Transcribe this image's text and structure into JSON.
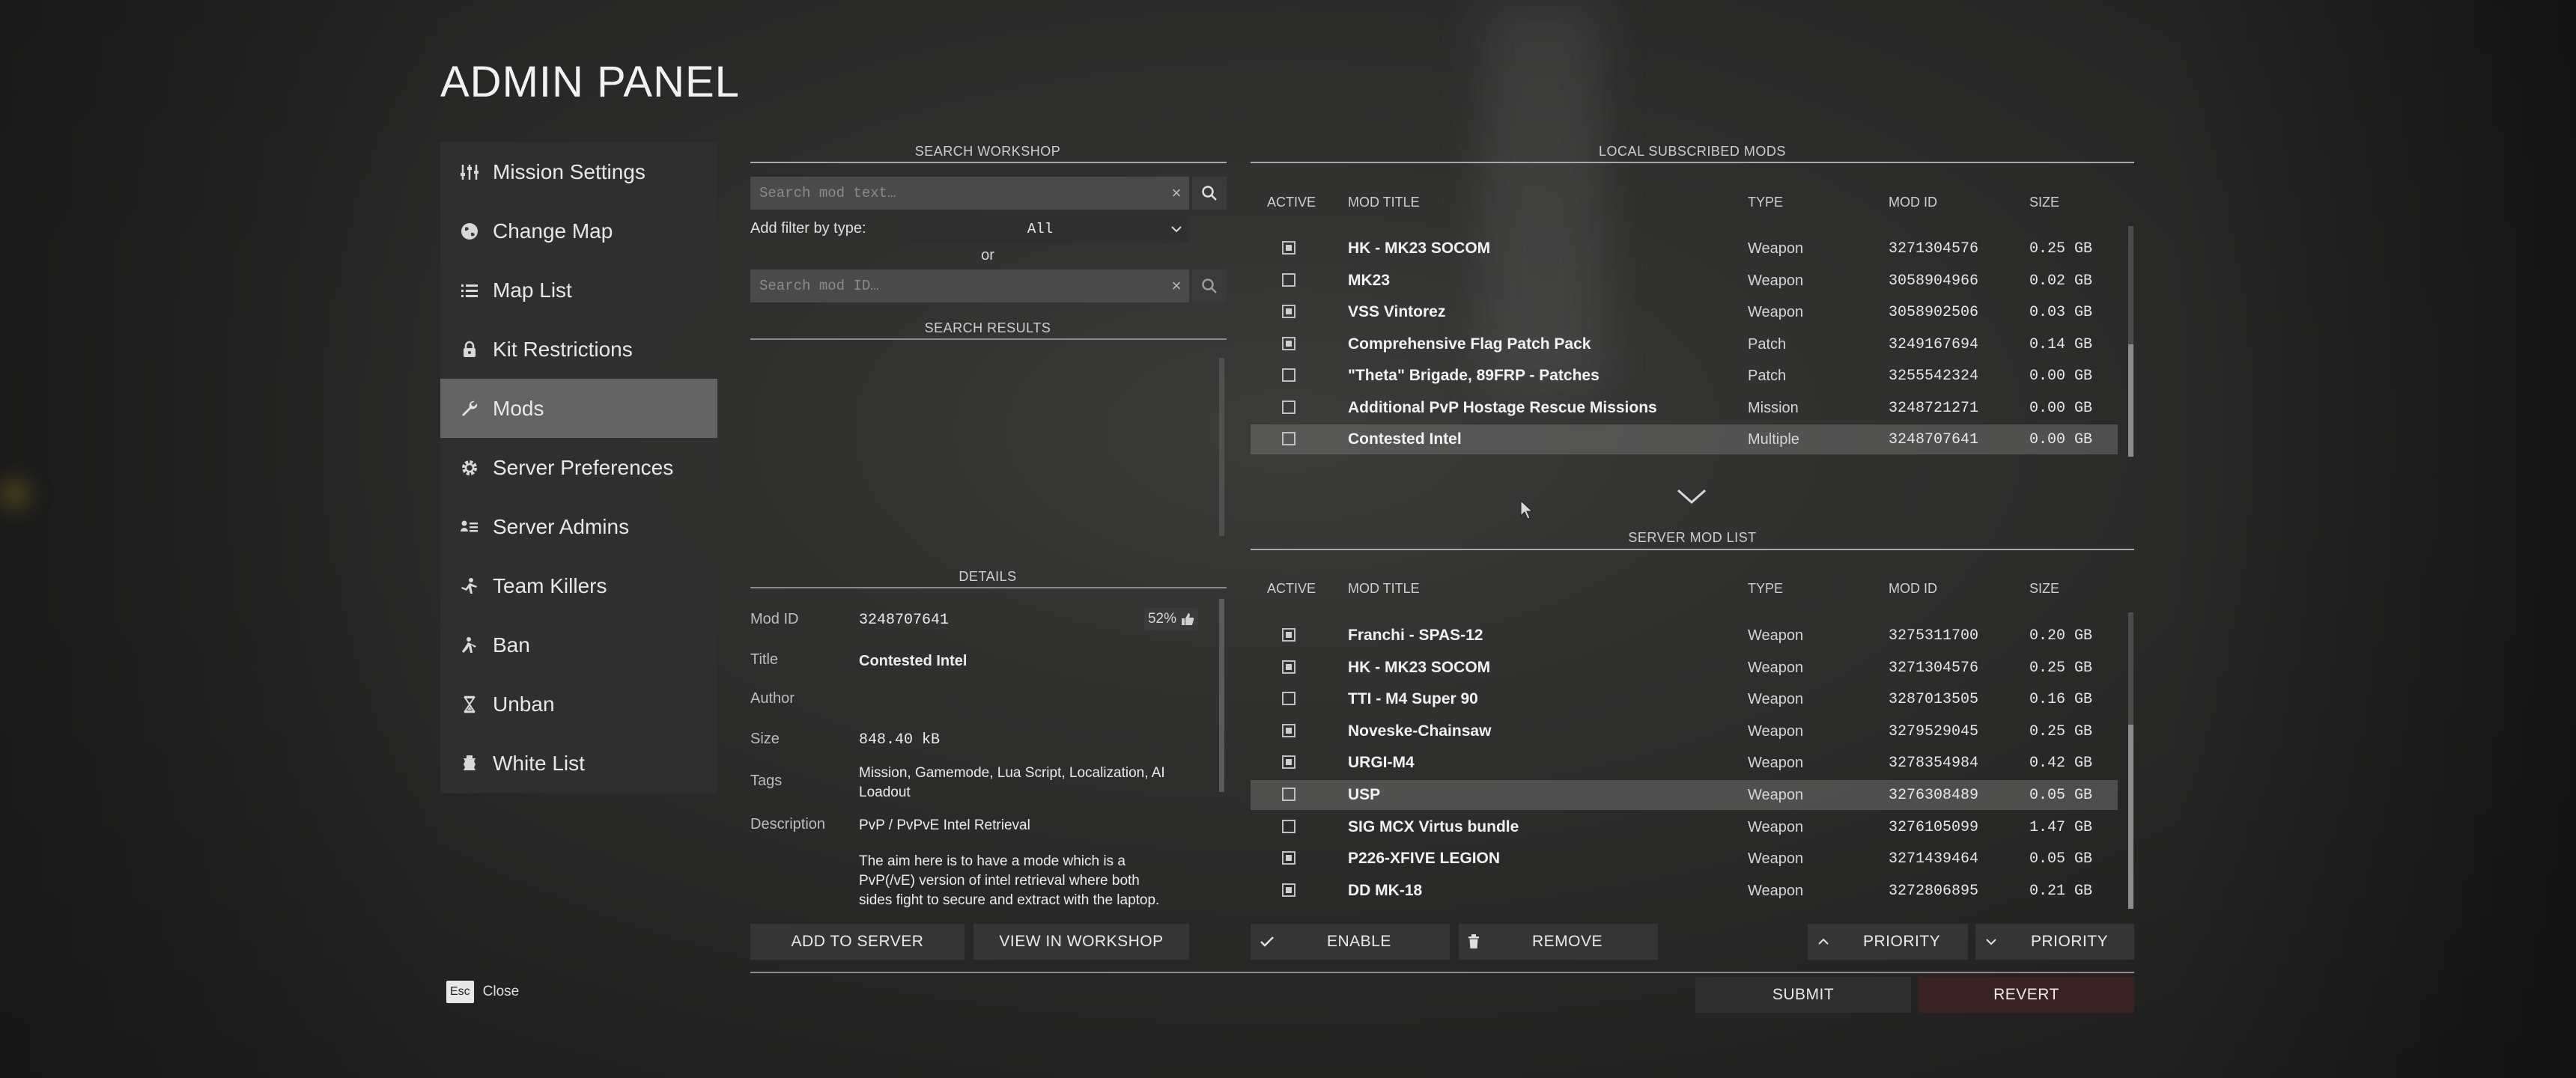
{
  "title": "ADMIN PANEL",
  "nav": [
    {
      "label": "Mission Settings",
      "icon": "sliders-icon"
    },
    {
      "label": "Change Map",
      "icon": "globe-icon"
    },
    {
      "label": "Map List",
      "icon": "list-icon"
    },
    {
      "label": "Kit Restrictions",
      "icon": "lock-icon"
    },
    {
      "label": "Mods",
      "icon": "wrench-icon",
      "active": true
    },
    {
      "label": "Server Preferences",
      "icon": "gear-icon"
    },
    {
      "label": "Server Admins",
      "icon": "admins-icon"
    },
    {
      "label": "Team Killers",
      "icon": "team-killer-icon"
    },
    {
      "label": "Ban",
      "icon": "ban-icon"
    },
    {
      "label": "Unban",
      "icon": "hourglass-icon"
    },
    {
      "label": "White List",
      "icon": "whitelist-icon"
    }
  ],
  "workshop": {
    "header": "SEARCH WORKSHOP",
    "search_placeholder": "Search mod text…",
    "filter_label": "Add filter by type:",
    "filter_value": "All",
    "or_label": "or",
    "id_placeholder": "Search mod ID…",
    "results_header": "SEARCH RESULTS"
  },
  "details": {
    "header": "DETAILS",
    "mod_id_label": "Mod ID",
    "mod_id": "3248707641",
    "rating": "52%",
    "title_label": "Title",
    "title": "Contested Intel",
    "author_label": "Author",
    "author": "",
    "size_label": "Size",
    "size": "848.40 kB",
    "tags_label": "Tags",
    "tags": "Mission, Gamemode, Lua Script, Localization, AI Loadout",
    "description_label": "Description",
    "description_1": "PvP / PvPvE Intel Retrieval",
    "description_2": "The aim here is to have a mode which is a PvP(/vE) version of intel retrieval where both sides fight to secure and extract with the laptop."
  },
  "buttons": {
    "add_to_server": "ADD TO SERVER",
    "view_in_workshop": "VIEW IN WORKSHOP",
    "enable": "ENABLE",
    "remove": "REMOVE",
    "priority_up": "PRIORITY",
    "priority_down": "PRIORITY",
    "submit": "SUBMIT",
    "revert": "REVERT"
  },
  "columns": {
    "active": "ACTIVE",
    "title": "MOD TITLE",
    "type": "TYPE",
    "id": "MOD ID",
    "size": "SIZE"
  },
  "local": {
    "header": "LOCAL SUBSCRIBED MODS",
    "rows": [
      {
        "active": true,
        "title": "HK - MK23 SOCOM",
        "type": "Weapon",
        "id": "3271304576",
        "size": "0.25 GB"
      },
      {
        "active": false,
        "title": "MK23",
        "type": "Weapon",
        "id": "3058904966",
        "size": "0.02 GB"
      },
      {
        "active": true,
        "title": "VSS Vintorez",
        "type": "Weapon",
        "id": "3058902506",
        "size": "0.03 GB"
      },
      {
        "active": true,
        "title": "Comprehensive Flag Patch Pack",
        "type": "Patch",
        "id": "3249167694",
        "size": "0.14 GB"
      },
      {
        "active": false,
        "title": "\"Theta\" Brigade, 89FRP - Patches",
        "type": "Patch",
        "id": "3255542324",
        "size": "0.00 GB"
      },
      {
        "active": false,
        "title": "Additional PvP Hostage Rescue Missions",
        "type": "Mission",
        "id": "3248721271",
        "size": "0.00 GB"
      },
      {
        "active": false,
        "title": "Contested Intel",
        "type": "Multiple",
        "id": "3248707641",
        "size": "0.00 GB",
        "selected": true
      }
    ]
  },
  "server": {
    "header": "SERVER MOD LIST",
    "rows": [
      {
        "active": true,
        "title": "Franchi - SPAS-12",
        "type": "Weapon",
        "id": "3275311700",
        "size": "0.20 GB"
      },
      {
        "active": true,
        "title": "HK - MK23 SOCOM",
        "type": "Weapon",
        "id": "3271304576",
        "size": "0.25 GB"
      },
      {
        "active": false,
        "title": "TTI - M4 Super 90",
        "type": "Weapon",
        "id": "3287013505",
        "size": "0.16 GB"
      },
      {
        "active": true,
        "title": "Noveske-Chainsaw",
        "type": "Weapon",
        "id": "3279529045",
        "size": "0.25 GB"
      },
      {
        "active": true,
        "title": "URGI-M4",
        "type": "Weapon",
        "id": "3278354984",
        "size": "0.42 GB"
      },
      {
        "active": false,
        "title": "USP",
        "type": "Weapon",
        "id": "3276308489",
        "size": "0.05 GB",
        "selected": true
      },
      {
        "active": false,
        "title": "SIG MCX Virtus bundle",
        "type": "Weapon",
        "id": "3276105099",
        "size": "1.47 GB"
      },
      {
        "active": true,
        "title": "P226-XFIVE LEGION",
        "type": "Weapon",
        "id": "3271439464",
        "size": "0.05 GB"
      },
      {
        "active": true,
        "title": "DD MK-18",
        "type": "Weapon",
        "id": "3272806895",
        "size": "0.21 GB"
      }
    ]
  },
  "close": {
    "key": "Esc",
    "label": "Close"
  }
}
